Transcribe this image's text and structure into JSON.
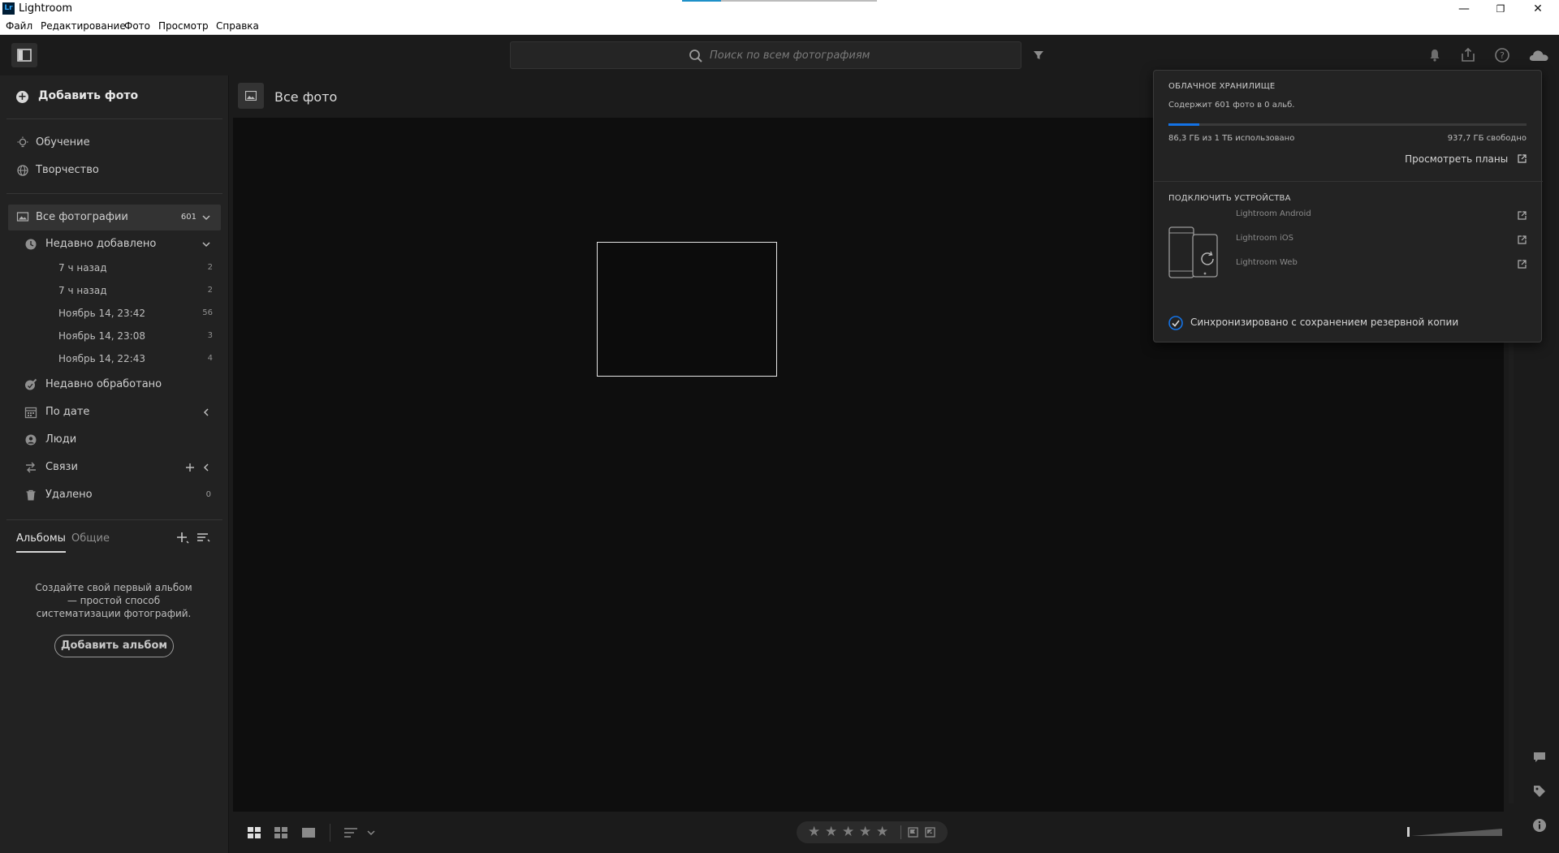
{
  "window": {
    "title": "Lightroom",
    "app_icon": "Lr",
    "minimize": "—",
    "restore": "❐",
    "close": "✕",
    "top_progress": 0.2
  },
  "menu": [
    "Файл",
    "Редактирование",
    "Фото",
    "Просмотр",
    "Справка"
  ],
  "toolbar": {
    "search_placeholder": "Поиск по всем фотографиям",
    "icons": [
      "panel-toggle-icon",
      "search-icon",
      "filter-icon",
      "bell-icon",
      "share-icon",
      "help-icon",
      "cloud-icon"
    ]
  },
  "sidebar": {
    "add_photo": "Добавить фото",
    "top_items": [
      {
        "label": "Обучение",
        "icon": "lightbulb-icon"
      },
      {
        "label": "Творчество",
        "icon": "globe-icon"
      }
    ],
    "all_photos": {
      "label": "Все фотографии",
      "count": "601"
    },
    "recent_added": {
      "label": "Недавно добавлено"
    },
    "recent_dates": [
      {
        "label": "7 ч назад",
        "count": "2"
      },
      {
        "label": "7 ч назад",
        "count": "2"
      },
      {
        "label": "Ноябрь 14, 23:42",
        "count": "56"
      },
      {
        "label": "Ноябрь 14, 23:08",
        "count": "3"
      },
      {
        "label": "Ноябрь 14, 22:43",
        "count": "4"
      }
    ],
    "recent_edited": "Недавно обработано",
    "by_date": "По дате",
    "people": "Люди",
    "connections": "Связи",
    "deleted": {
      "label": "Удалено",
      "count": "0"
    },
    "album_tabs": {
      "albums": "Альбомы",
      "shared": "Общие"
    },
    "album_empty_text": "Создайте свой первый альбом — простой способ систематизации фотографий.",
    "add_album": "Добавить альбом"
  },
  "main": {
    "title": "Все фото"
  },
  "cloud_panel": {
    "storage_header": "ОБЛАЧНОЕ ХРАНИЛИЩЕ",
    "contains": "Содержит 601 фото в 0 альб.",
    "used": "86,3 ГБ из 1 ТБ использовано",
    "free": "937,7 ГБ свободно",
    "usage_fraction": 0.0863,
    "view_plans": "Просмотреть планы",
    "devices_header": "ПОДКЛЮЧИТЬ УСТРОЙСТВА",
    "devices": [
      "Lightroom Android",
      "Lightroom iOS",
      "Lightroom Web"
    ],
    "sync_status": "Синхронизировано с сохранением резервной копии",
    "accent_color": "#1473e6"
  },
  "bottombar": {
    "stars": [
      "★",
      "★",
      "★",
      "★",
      "★"
    ],
    "view_icons": [
      "square-grid-icon",
      "grid-icon",
      "single-view-icon",
      "sort-icon"
    ]
  }
}
